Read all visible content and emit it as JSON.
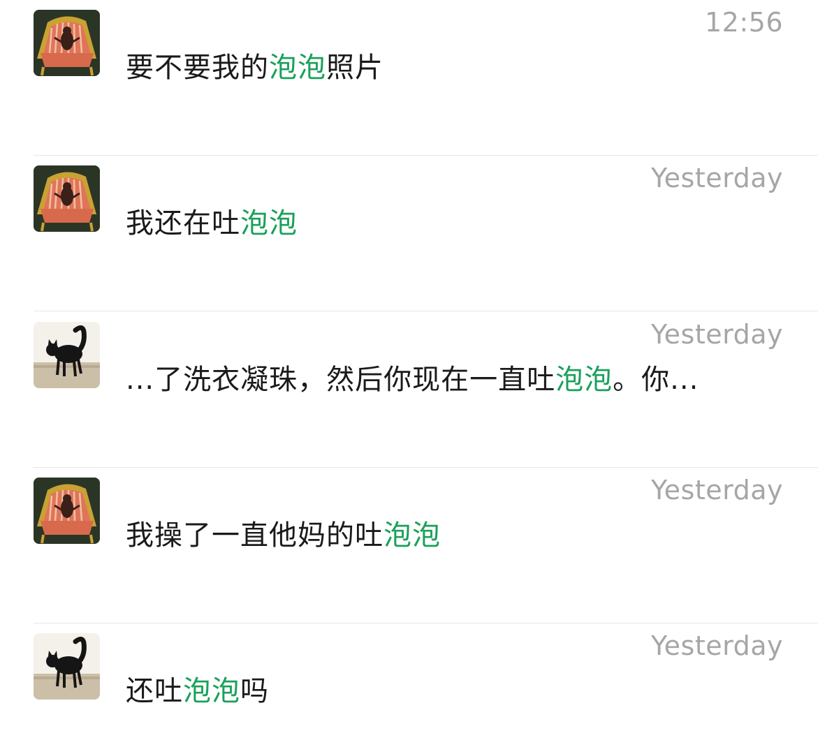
{
  "colors": {
    "highlight": "#1aa05a",
    "timestamp": "#a6a6a6",
    "text": "#1a1a1a",
    "divider": "#e6e6e6"
  },
  "results": [
    {
      "avatar_icon": "armchair-photo-icon",
      "time": "12:56",
      "parts": [
        "要不要我的",
        "泡泡",
        "照片"
      ]
    },
    {
      "avatar_icon": "armchair-photo-icon",
      "time": "Yesterday",
      "parts": [
        "我还在吐",
        "泡泡",
        ""
      ]
    },
    {
      "avatar_icon": "black-cat-photo-icon",
      "time": "Yesterday",
      "parts": [
        "...了洗衣凝珠，然后你现在一直吐",
        "泡泡",
        "。你..."
      ]
    },
    {
      "avatar_icon": "armchair-photo-icon",
      "time": "Yesterday",
      "parts": [
        "我操了一直他妈的吐",
        "泡泡",
        ""
      ]
    },
    {
      "avatar_icon": "black-cat-photo-icon",
      "time": "Yesterday",
      "parts": [
        "还吐",
        "泡泡",
        "吗"
      ]
    }
  ]
}
